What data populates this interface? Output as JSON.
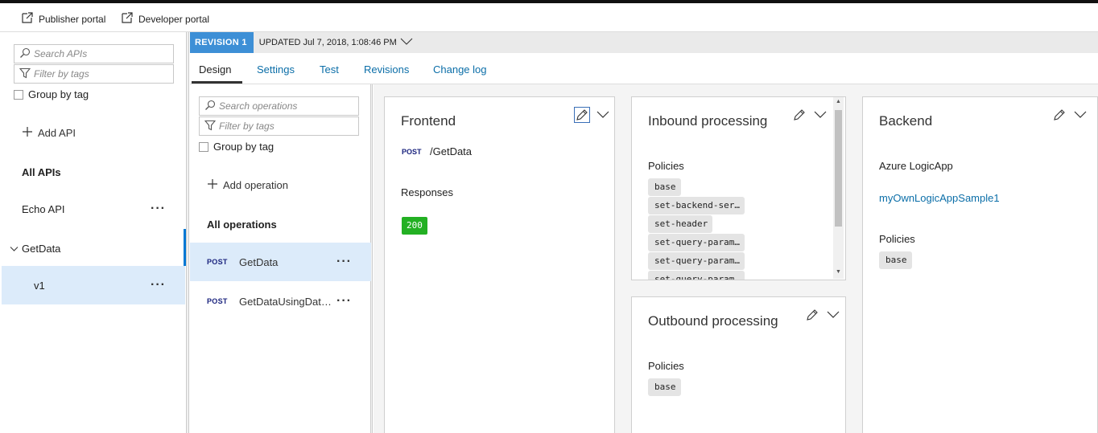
{
  "topbar": {
    "publisher_portal": "Publisher portal",
    "developer_portal": "Developer portal"
  },
  "left": {
    "search_placeholder": "Search APIs",
    "filter_placeholder": "Filter by tags",
    "group_by_tag": "Group by tag",
    "add_api": "Add API",
    "all_apis": "All APIs",
    "apis": [
      {
        "name": "Echo API"
      },
      {
        "name": "GetData"
      },
      {
        "name": "v1"
      }
    ]
  },
  "revision": {
    "badge": "REVISION 1",
    "updated": "UPDATED Jul 7, 2018, 1:08:46 PM"
  },
  "tabs": [
    "Design",
    "Settings",
    "Test",
    "Revisions",
    "Change log"
  ],
  "ops": {
    "search_placeholder": "Search operations",
    "filter_placeholder": "Filter by tags",
    "group_by_tag": "Group by tag",
    "add_operation": "Add operation",
    "all_operations": "All operations",
    "items": [
      {
        "method": "POST",
        "name": "GetData"
      },
      {
        "method": "POST",
        "name": "GetDataUsingData..."
      }
    ]
  },
  "frontend": {
    "title": "Frontend",
    "method": "POST",
    "path": "/GetData",
    "responses_label": "Responses",
    "response_code": "200"
  },
  "inbound": {
    "title": "Inbound processing",
    "policies_label": "Policies",
    "policies": [
      "base",
      "set-backend-ser…",
      "set-header",
      "set-query-param…",
      "set-query-param…",
      "set-query-param…"
    ]
  },
  "outbound": {
    "title": "Outbound processing",
    "policies_label": "Policies",
    "policies": [
      "base"
    ]
  },
  "backend": {
    "title": "Backend",
    "type": "Azure LogicApp",
    "link": "myOwnLogicAppSample1",
    "policies_label": "Policies",
    "policies": [
      "base"
    ]
  },
  "colors": {
    "accent": "#0078d4",
    "revision_badge": "#3d8fd6",
    "selected_row": "#dcebfa",
    "success": "#23b023",
    "link": "#0b6ea8"
  }
}
